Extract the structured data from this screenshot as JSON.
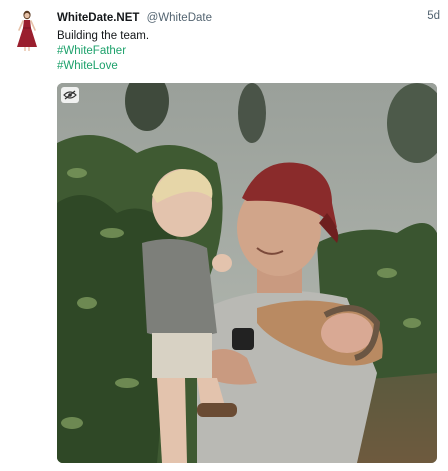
{
  "tweet": {
    "display_name": "WhiteDate.NET",
    "handle": "@WhiteDate",
    "time": "5d",
    "lines": [
      "Building the team."
    ],
    "hashtags": [
      "#WhiteFather",
      "#WhiteLove"
    ]
  },
  "icons": {
    "avatar": "woman-red-dress-avatar",
    "media_toggle": "eye-slash-icon"
  },
  "colors": {
    "hashtag": "#1da16b",
    "handle": "#536471"
  }
}
